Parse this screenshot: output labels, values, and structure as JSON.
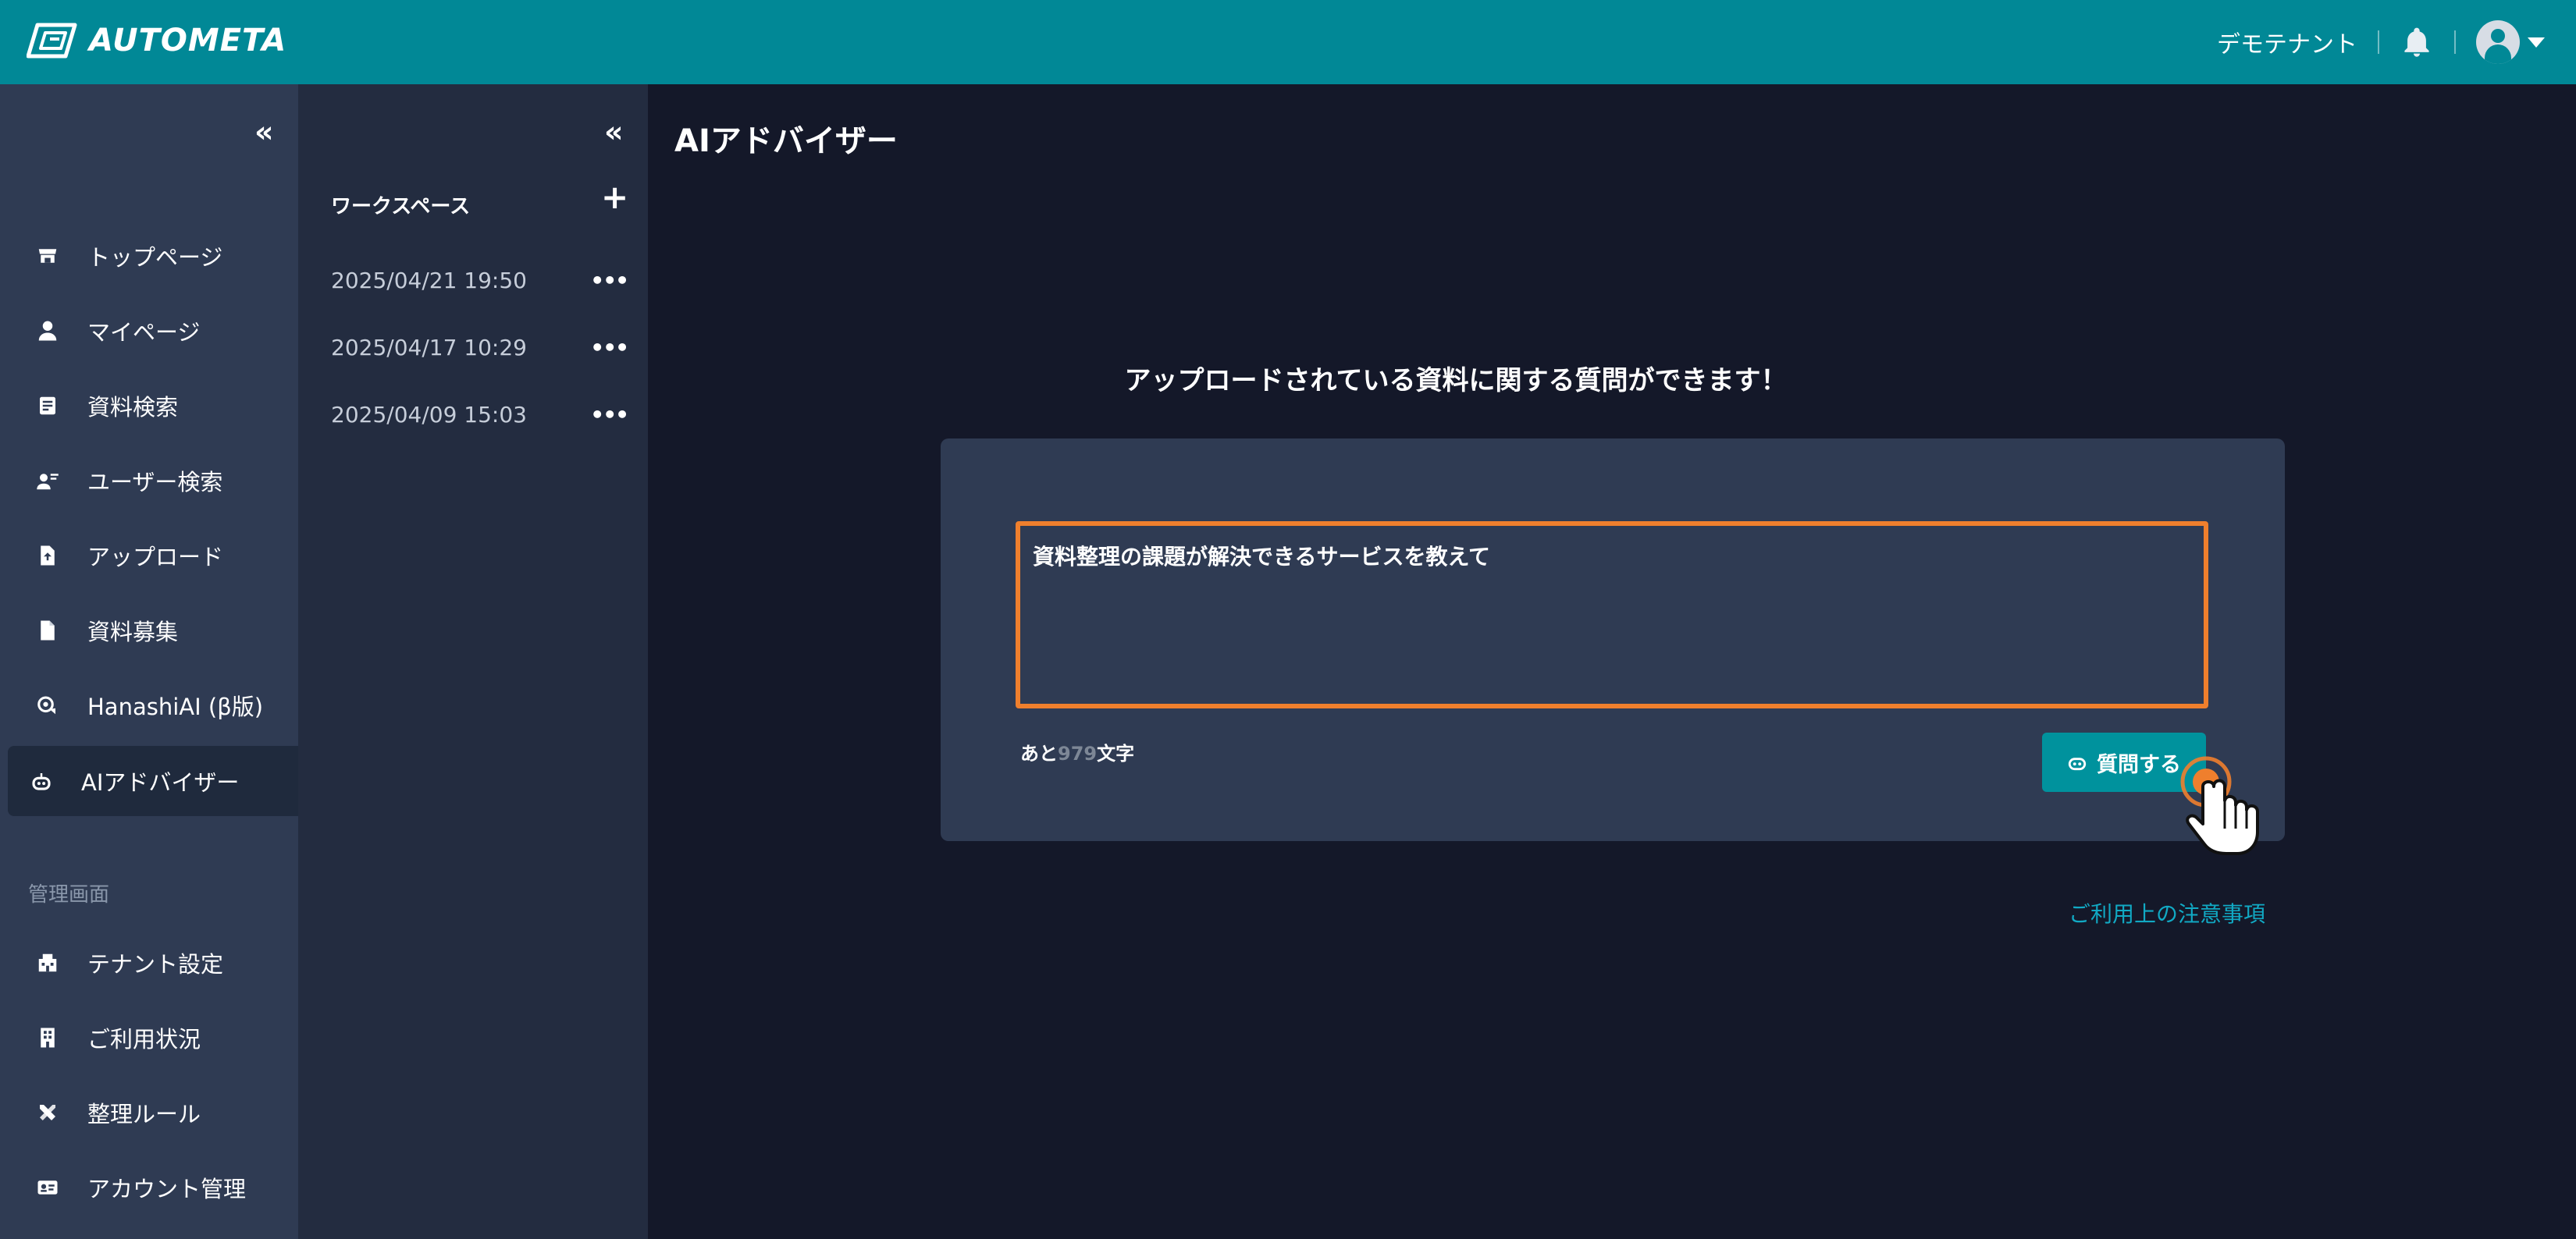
{
  "header": {
    "brand": "AUTOMETA",
    "tenant": "デモテナント"
  },
  "sidebar": {
    "collapse": "«",
    "items": [
      {
        "label": "トップページ",
        "icon": "store-icon"
      },
      {
        "label": "マイページ",
        "icon": "user-icon"
      },
      {
        "label": "資料検索",
        "icon": "document-search-icon"
      },
      {
        "label": "ユーザー検索",
        "icon": "user-search-icon"
      },
      {
        "label": "アップロード",
        "icon": "file-upload-icon"
      },
      {
        "label": "資料募集",
        "icon": "file-icon"
      },
      {
        "label": "HanashiAI (β版)",
        "icon": "chat-bot-icon"
      },
      {
        "label": "AIアドバイザー",
        "icon": "robot-icon",
        "active": true
      }
    ],
    "admin_section": "管理画面",
    "admin_items": [
      {
        "label": "テナント設定",
        "icon": "building-settings-icon"
      },
      {
        "label": "ご利用状況",
        "icon": "building-icon"
      },
      {
        "label": "整理ルール",
        "icon": "tools-icon"
      },
      {
        "label": "アカウント管理",
        "icon": "id-card-icon"
      }
    ]
  },
  "workspace": {
    "collapse": "«",
    "title": "ワークスペース",
    "add": "+",
    "items": [
      {
        "datetime": "2025/04/21 19:50",
        "menu": "•••"
      },
      {
        "datetime": "2025/04/17 10:29",
        "menu": "•••"
      },
      {
        "datetime": "2025/04/09 15:03",
        "menu": "•••"
      }
    ]
  },
  "main": {
    "title": "AIアドバイザー",
    "intro": "アップロードされている資料に関する質問ができます！",
    "question_value": "資料整理の課題が解決できるサービスを教えて",
    "counter_prefix": "あと",
    "counter_remaining": "979",
    "counter_suffix": "文字",
    "ask_button": "質問する",
    "notice_link": "ご利用上の注意事項"
  },
  "colors": {
    "header": "#018896",
    "sidebar": "#2f3b53",
    "workspace": "#232c40",
    "background": "#141829",
    "highlight": "#ef7f2d",
    "button": "#00929d",
    "link": "#11a9c4"
  }
}
